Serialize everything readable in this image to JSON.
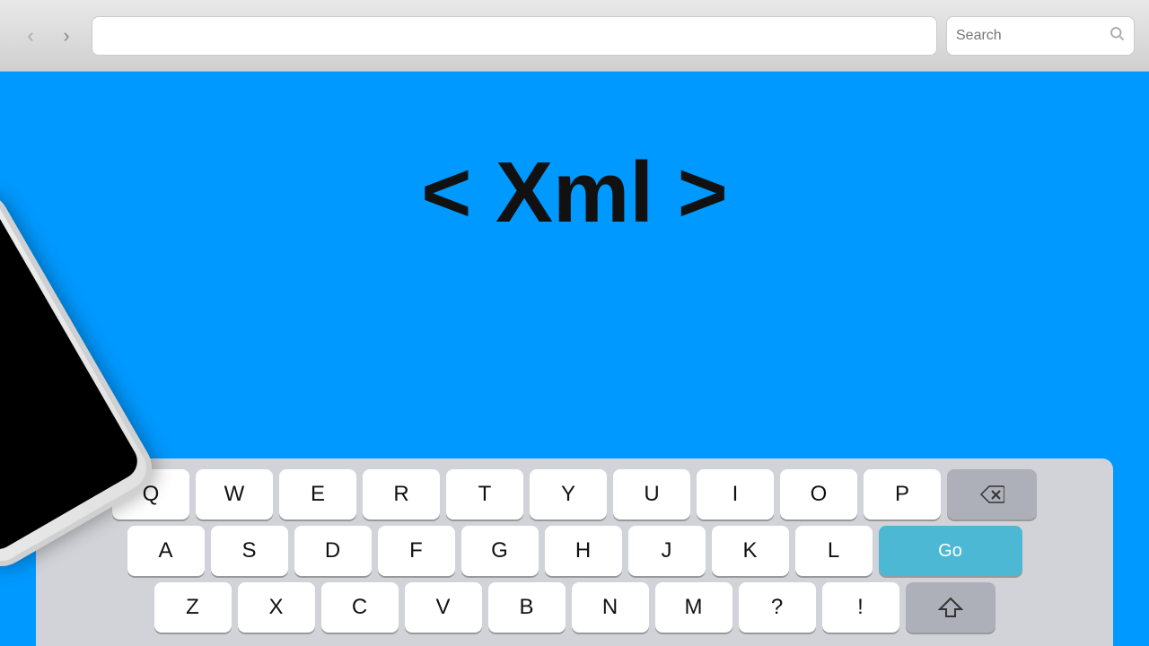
{
  "toolbar": {
    "back_label": "‹",
    "forward_label": "›",
    "address_placeholder": "",
    "search_placeholder": "Search"
  },
  "main": {
    "title": "< Xml >"
  },
  "keyboard": {
    "row1": [
      "Q",
      "W",
      "E",
      "R",
      "T",
      "Y",
      "U",
      "I",
      "O",
      "P"
    ],
    "row2": [
      "A",
      "S",
      "D",
      "F",
      "G",
      "H",
      "J",
      "K",
      "L"
    ],
    "row3": [
      "Z",
      "X",
      "C",
      "V",
      "B",
      "N",
      "M",
      "?",
      "!"
    ],
    "go_label": "Go",
    "backspace_label": "⌫",
    "shift_label": "⇧"
  }
}
